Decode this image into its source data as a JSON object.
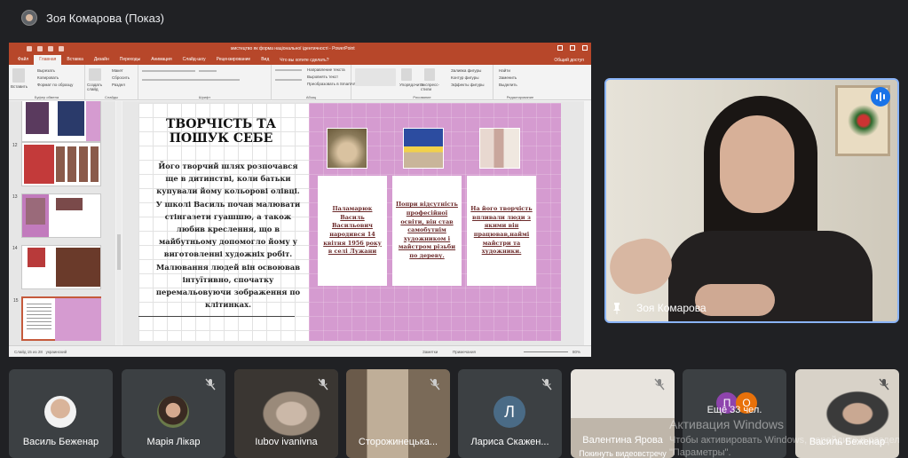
{
  "meeting": {
    "presenter_title": "Зоя Комарова (Показ)"
  },
  "powerpoint": {
    "document_title": "мистецтво як форма національної ідентичності - PowerPoint",
    "tabs": [
      "Файл",
      "Главная",
      "Вставка",
      "Дизайн",
      "Переходы",
      "Анимация",
      "Слайд-шоу",
      "Рецензирование",
      "Вид"
    ],
    "active_tab": "Главная",
    "search_hint": "Что вы хотите сделать?",
    "share_label": "Общий доступ",
    "ribbon_groups": [
      "Буфер обмена",
      "Слайды",
      "Шрифт",
      "Абзац",
      "Рисование",
      "Редактирование"
    ],
    "ribbon_items": {
      "paste": "Вставить",
      "cut": "Вырезать",
      "copy": "Копировать",
      "format_painter": "Формат по образцу",
      "new_slide": "Создать слайд",
      "layout": "Макет",
      "reset": "Сбросить",
      "section": "Раздел",
      "text_direction": "Направление текста",
      "align_text": "Выровнять текст",
      "smartart": "Преобразовать в SmartArt",
      "arrange": "Упорядочить",
      "quick_styles": "Экспресс-стили",
      "shape_fill": "Заливка фигуры",
      "shape_outline": "Контур фигуры",
      "shape_effects": "Эффекты фигуры",
      "find": "Найти",
      "replace": "Заменить",
      "select": "Выделить"
    },
    "thumb_numbers": [
      "12",
      "13",
      "14",
      "15"
    ],
    "status": {
      "slide_counter": "Слайд 15 из 28",
      "language": "украинский",
      "notes": "Заметки",
      "comments": "Примечания",
      "zoom": "80%"
    }
  },
  "slide": {
    "title": "ТВОРЧІСТЬ ТА ПОШУК СЕБЕ",
    "body": "Його творчий шлях розпочався ще в дитинстві, коли батьки купували йому кольорові олівці. У школі Василь почав малювати стінгазети гуашшю, а також любив креслення, що в майбутньому допомогло йому у виготовленні художніх робіт. Малювання людей він освоював інтуїтивно, спочатку перемальовуючи зображення по клітинках.",
    "cards": [
      "Паламарюк Василь Васильович народився 14 квітня 1956 року в селі Лужани",
      "Попри відсутність професійної освіти, він став самобутнім художником і майстром різьби по дереву.",
      "На його творчість впливали люди з якими він працював,наймі майстри та художники."
    ]
  },
  "speaker": {
    "name": "Зоя Комарова"
  },
  "participants": [
    {
      "name": "Василь Беженар",
      "type": "photo"
    },
    {
      "name": "Марія Лікар",
      "type": "photo"
    },
    {
      "name": "Iubov ivanivna",
      "type": "video"
    },
    {
      "name": "Сторожинецька...",
      "type": "video"
    },
    {
      "name": "Лариса Скажен...",
      "type": "letter",
      "letter": "Л"
    },
    {
      "name": "Валентина Ярова",
      "type": "video",
      "subtitle": "Покинуть видеовстречу"
    },
    {
      "name": "Ещё 33 чел.",
      "type": "more",
      "letters": [
        "П",
        "О"
      ]
    },
    {
      "name": "Василь Беженар",
      "type": "video"
    }
  ],
  "windows_watermark": {
    "line1": "Активация Windows",
    "line2": "Чтобы активировать Windows, перейдите в раздел \"Параметры\"."
  },
  "colors": {
    "ppt_red": "#b7472a",
    "slide_pink": "#d59bd0",
    "active_border": "#8ab4f8"
  }
}
